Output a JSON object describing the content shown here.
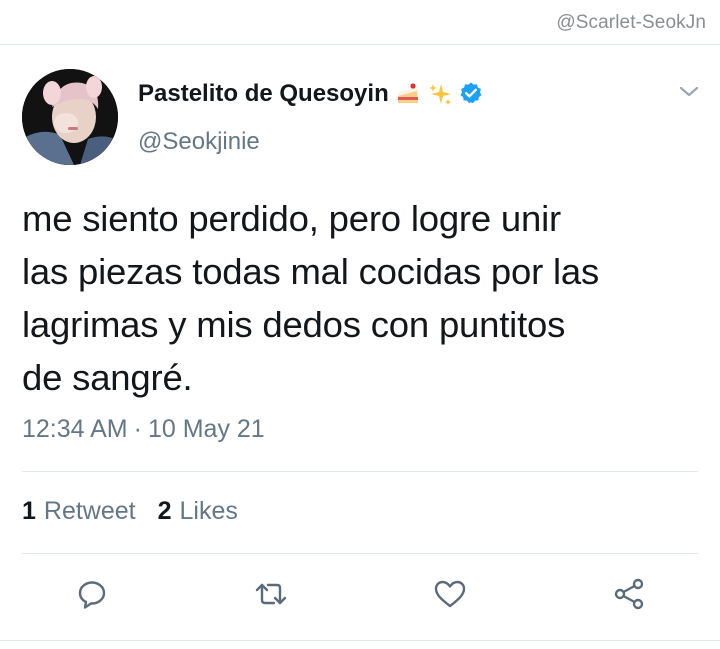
{
  "watermark": "@Scarlet-SeokJn",
  "tweet": {
    "author": {
      "display_name": "Pastelito de Quesoyin",
      "emojis": [
        "cake-emoji",
        "sparkles-emoji"
      ],
      "verified": true,
      "handle": "@Seokjinie"
    },
    "text_lines": [
      "me siento perdido, pero logre unir",
      "las piezas todas mal cocidas por las",
      "lagrimas y mis dedos con puntitos",
      "de sangré."
    ],
    "time": "12:34 AM",
    "separator": "·",
    "date": "10 May 21",
    "retweets": {
      "count": "1",
      "label": "Retweet"
    },
    "likes": {
      "count": "2",
      "label": "Likes"
    }
  },
  "icons": {
    "reply": "comment-icon",
    "retweet": "retweet-icon",
    "like": "heart-icon",
    "share": "share-icon",
    "menu": "chevron-down-icon",
    "verified": "verified-badge-icon"
  },
  "colors": {
    "text": "#14171a",
    "secondary": "#657786",
    "verified": "#1da1f2",
    "divider": "#e1e8ed"
  }
}
